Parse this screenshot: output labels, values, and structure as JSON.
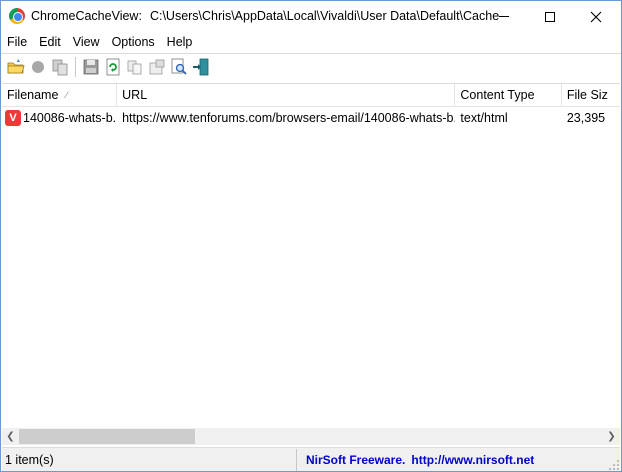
{
  "window": {
    "app_name": "ChromeCacheView:",
    "path": "C:\\Users\\Chris\\AppData\\Local\\Vivaldi\\User Data\\Default\\Cache"
  },
  "menu": {
    "items": [
      {
        "label": "File"
      },
      {
        "label": "Edit"
      },
      {
        "label": "View"
      },
      {
        "label": "Options"
      },
      {
        "label": "Help"
      }
    ]
  },
  "toolbar": {
    "icons": [
      "open-folder-icon",
      "stop-icon",
      "copy-files-icon",
      "save-icon",
      "refresh-icon",
      "copy-icon",
      "properties-icon",
      "find-icon",
      "exit-icon"
    ]
  },
  "columns": [
    {
      "label": "Filename"
    },
    {
      "label": "URL"
    },
    {
      "label": "Content Type"
    },
    {
      "label": "File Siz"
    }
  ],
  "rows": [
    {
      "filename": "140086-whats-b...",
      "url": "https://www.tenforums.com/browsers-email/140086-whats-b...",
      "content_type": "text/html",
      "file_size": "23,395",
      "icon": "vivaldi-icon",
      "icon_glyph": "V"
    }
  ],
  "status": {
    "count": "1 item(s)",
    "brand": "NirSoft Freeware.",
    "link": "http://www.nirsoft.net"
  },
  "colors": {
    "accent_link": "#0000cc",
    "vivaldi_red": "#ef3939"
  }
}
